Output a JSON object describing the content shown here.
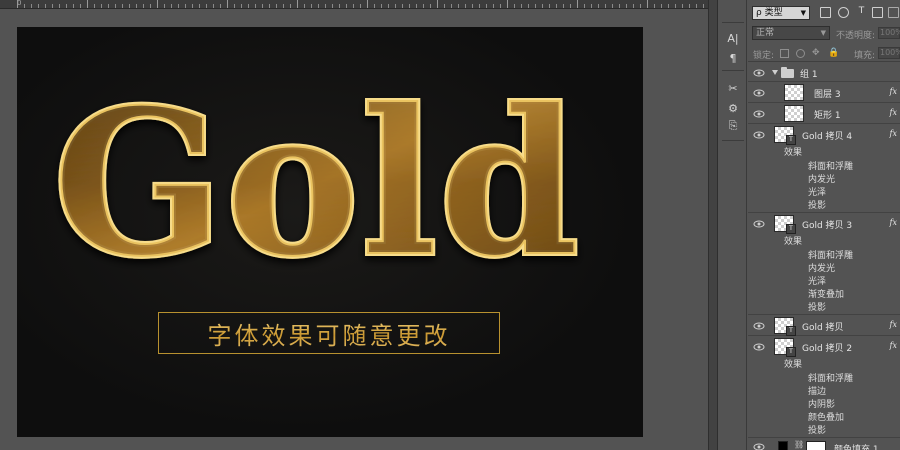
{
  "ruler": {
    "zero_label": "0"
  },
  "canvas": {
    "headline": "Gold",
    "subtitle": "字体效果可随意更改",
    "colors": {
      "gold_light": "#f6d987",
      "gold_mid": "#c9962f",
      "gold_dark": "#6a4a12",
      "frame": "#b8912f",
      "background": "#101010"
    }
  },
  "tools": {
    "items": [
      {
        "name": "character-icon",
        "glyph": "A|"
      },
      {
        "name": "paragraph-icon",
        "glyph": "¶"
      },
      {
        "name": "tool-presets-icon",
        "glyph": "✂"
      },
      {
        "name": "layer-comps-icon",
        "glyph": "⚙"
      },
      {
        "name": "clone-source-icon",
        "glyph": "⎘"
      }
    ]
  },
  "layers_panel": {
    "filter": {
      "kind_label": "ρ 类型"
    },
    "blend_mode": "正常",
    "opacity_label": "不透明度:",
    "opacity_value": "100%",
    "lock_label": "锁定:",
    "fill_label": "填充:",
    "fill_value": "100%",
    "rows": [
      {
        "type": "group",
        "name": "组 1"
      },
      {
        "type": "layer",
        "name": "图层 3",
        "fx": "fx"
      },
      {
        "type": "layer",
        "name": "矩形 1",
        "fx": "fx"
      },
      {
        "type": "text",
        "name": "Gold 拷贝 4",
        "fx": "fx",
        "effects_label": "效果",
        "effects": [
          "斜面和浮雕",
          "内发光",
          "光泽",
          "投影"
        ]
      },
      {
        "type": "text",
        "name": "Gold 拷贝 3",
        "fx": "fx",
        "effects_label": "效果",
        "effects": [
          "斜面和浮雕",
          "内发光",
          "光泽",
          "渐变叠加",
          "投影"
        ]
      },
      {
        "type": "text",
        "name": "Gold 拷贝",
        "fx": "fx"
      },
      {
        "type": "text",
        "name": "Gold 拷贝 2",
        "fx": "fx",
        "effects_label": "效果",
        "effects": [
          "描边",
          "斜面和浮雕",
          "内阴影",
          "颜色叠加",
          "投影"
        ]
      },
      {
        "type": "fill",
        "name": "颜色填充 1"
      }
    ]
  }
}
